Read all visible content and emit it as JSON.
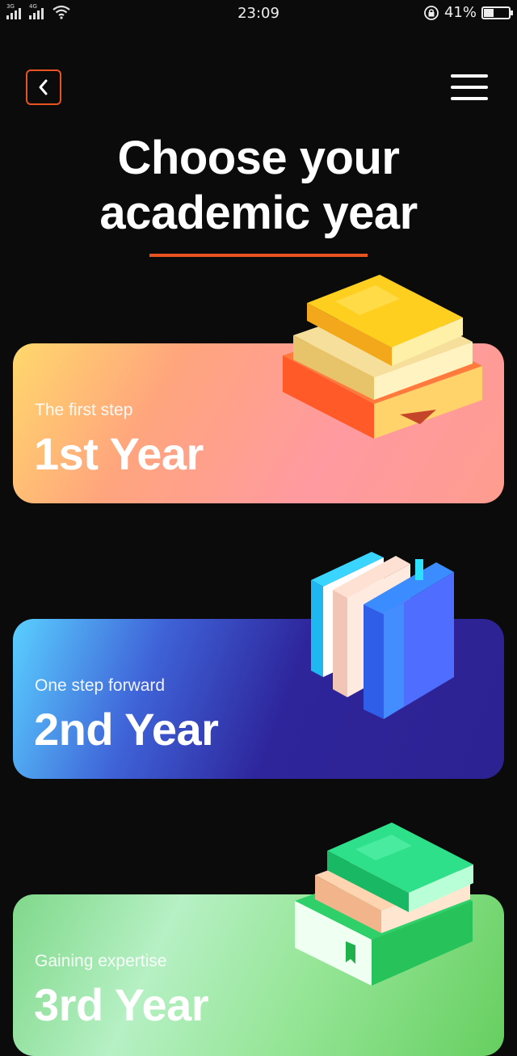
{
  "status_bar": {
    "signal_1_label": "3G",
    "signal_2_label": "4G",
    "time": "23:09",
    "battery_percent": "41%",
    "battery_level": 0.41
  },
  "header": {
    "back_icon": "chevron-left-icon",
    "menu_icon": "hamburger-menu-icon"
  },
  "title": {
    "line1": "Choose your",
    "line2": "academic year"
  },
  "colors": {
    "accent": "#e8531f",
    "background": "#0b0b0b"
  },
  "cards": [
    {
      "subtitle": "The first step",
      "label": "1st Year"
    },
    {
      "subtitle": "One step forward",
      "label": "2nd Year"
    },
    {
      "subtitle": "Gaining expertise",
      "label": "3rd Year"
    }
  ]
}
